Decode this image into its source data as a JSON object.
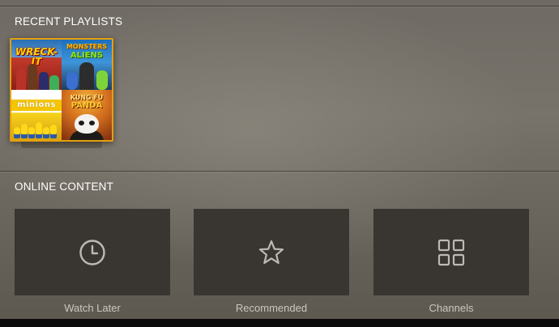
{
  "sections": {
    "recent_playlists": {
      "title": "RECENT PLAYLISTS",
      "playlist": {
        "posters": [
          {
            "title": "WRECK-IT"
          },
          {
            "title_line1": "MONSTERS",
            "title_line2": "ALIENS"
          },
          {
            "title": "minions"
          },
          {
            "title_line1": "KUNG FU",
            "title_line2": "PANDA"
          }
        ],
        "selected": true
      }
    },
    "online_content": {
      "title": "ONLINE CONTENT",
      "cards": [
        {
          "label": "Watch Later",
          "icon": "clock-icon"
        },
        {
          "label": "Recommended",
          "icon": "star-icon"
        },
        {
          "label": "Channels",
          "icon": "grid-icon"
        }
      ]
    }
  },
  "colors": {
    "selection_border": "#e5a00d",
    "card_background": "#393631",
    "card_icon": "#bdbab4",
    "card_label": "#c9c6c0",
    "section_title": "#ffffff"
  }
}
